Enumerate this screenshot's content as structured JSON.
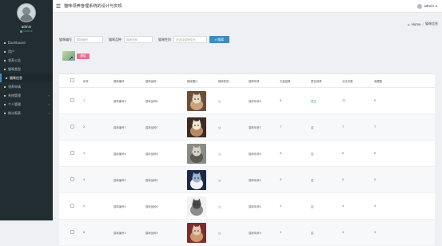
{
  "app": {
    "title": "猫咪领养管理系统的设计与实现"
  },
  "profile": {
    "name": "admin",
    "status": "Online"
  },
  "sidebar": {
    "items": [
      {
        "label": "Dashboard",
        "icon": "dashboard-icon",
        "active": false
      },
      {
        "label": "用户",
        "icon": "user-icon",
        "active": false
      },
      {
        "label": "领养公告",
        "icon": "notice-icon",
        "active": false
      },
      {
        "label": "猫咪类型",
        "icon": "tag-icon",
        "active": false
      },
      {
        "label": "猫咪信息",
        "icon": "cat-icon",
        "active": true
      },
      {
        "label": "领养申请",
        "icon": "form-icon",
        "active": false
      },
      {
        "label": "系统管理",
        "icon": "gear-icon",
        "active": false,
        "chev": true
      },
      {
        "label": "个人管理",
        "icon": "person-icon",
        "active": false,
        "chev": true
      },
      {
        "label": "统计报表",
        "icon": "chart-icon",
        "active": false,
        "chev": true
      }
    ]
  },
  "topbar": {
    "user": "admin"
  },
  "breadcrumb": {
    "home": "Home",
    "current": "猫咪信息"
  },
  "filters": {
    "f1_label": "猫咪编号",
    "f1_placeholder": "猫咪编号",
    "f2_label": "猫咪品种",
    "f2_placeholder": "猫咪品种",
    "f3_label": "猫咪性别",
    "f3_placeholder": "请选择猫咪性别",
    "search_label": "搜索"
  },
  "toolbar": {
    "delete_label": "删除"
  },
  "table": {
    "columns": [
      "序号",
      "猫咪编号",
      "猫咪品种",
      "猫咪图片",
      "猫咪性别",
      "猫咪年龄",
      "打疫苗数",
      "是否领养",
      "点击次数",
      "收藏数",
      "操作"
    ],
    "rows": [
      {
        "idx": "1",
        "code": "猫咪编号8",
        "breed": "猫咪品种8",
        "gender": "公",
        "age": "猫咪年龄8",
        "vaccine": "8",
        "adopted": "是否",
        "clicks": "12",
        "favs": "9"
      },
      {
        "idx": "2",
        "code": "猫咪编号7",
        "breed": "猫咪品种7",
        "gender": "公",
        "age": "猫咪年龄7",
        "vaccine": "7",
        "adopted": "否",
        "clicks": "7",
        "favs": "7"
      },
      {
        "idx": "3",
        "code": "猫咪编号6",
        "breed": "猫咪品种6",
        "gender": "公",
        "age": "猫咪年龄6",
        "vaccine": "6",
        "adopted": "否",
        "clicks": "6",
        "favs": "6"
      },
      {
        "idx": "4",
        "code": "猫咪编号5",
        "breed": "猫咪品种5",
        "gender": "公",
        "age": "猫咪年龄5",
        "vaccine": "5",
        "adopted": "否",
        "clicks": "5",
        "favs": "5"
      },
      {
        "idx": "5",
        "code": "猫咪编号4",
        "breed": "猫咪品种4",
        "gender": "公",
        "age": "猫咪年龄4",
        "vaccine": "4",
        "adopted": "否",
        "clicks": "4",
        "favs": "4"
      },
      {
        "idx": "6",
        "code": "猫咪编号3",
        "breed": "猫咪品种3",
        "gender": "公",
        "age": "猫咪年龄3",
        "vaccine": "3",
        "adopted": "否",
        "clicks": "3",
        "favs": "3"
      }
    ],
    "op_view": "详情",
    "op_edit": "修改",
    "op_delete": "删除"
  },
  "colors": {
    "sidebar_bg": "#222d32",
    "accent": "#3c8dbc",
    "danger": "#e96f91"
  }
}
